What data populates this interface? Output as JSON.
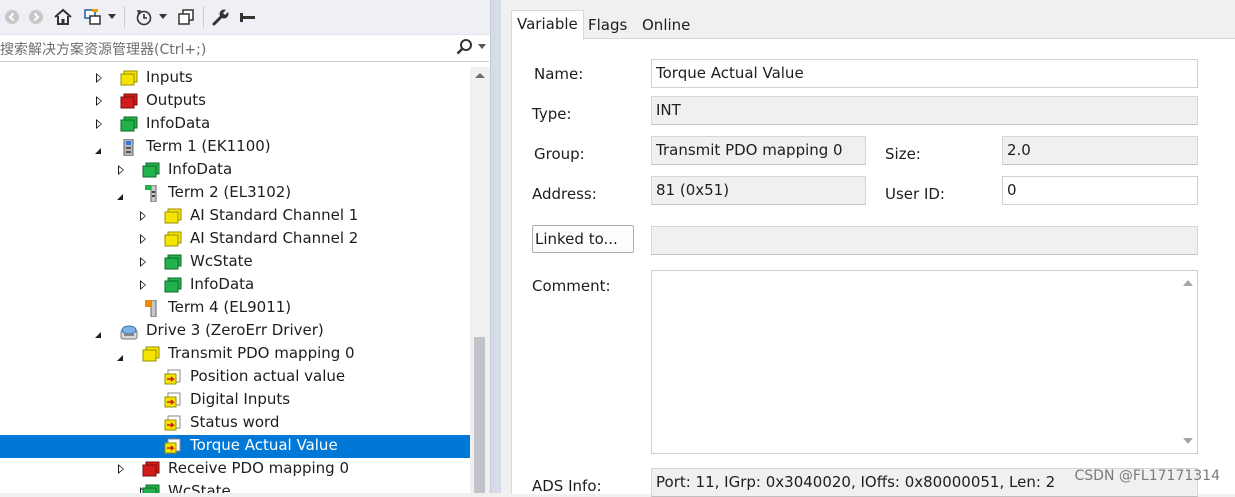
{
  "toolbar": {
    "icons": [
      "back-arrow-icon",
      "forward-arrow-icon",
      "home-icon",
      "sync-icon",
      "dropdown",
      "history-icon",
      "dropdown",
      "copy-window-icon",
      "wrench-icon",
      "minus-icon"
    ]
  },
  "search": {
    "placeholder": "搜索解决方案资源管理器(Ctrl+;)"
  },
  "tree": [
    {
      "label": "Inputs",
      "icon": "yellow",
      "expander": "closed"
    },
    {
      "label": "Outputs",
      "icon": "red",
      "expander": "closed"
    },
    {
      "label": "InfoData",
      "icon": "green",
      "expander": "closed"
    },
    {
      "label": "Term 1 (EK1100)",
      "icon": "coupler",
      "expander": "open"
    },
    {
      "label": "InfoData",
      "icon": "green",
      "expander": "closed"
    },
    {
      "label": "Term 2 (EL3102)",
      "icon": "terminal-green",
      "expander": "open"
    },
    {
      "label": "AI Standard Channel 1",
      "icon": "yellow",
      "expander": "closed"
    },
    {
      "label": "AI Standard Channel 2",
      "icon": "yellow",
      "expander": "closed"
    },
    {
      "label": "WcState",
      "icon": "green",
      "expander": "closed"
    },
    {
      "label": "InfoData",
      "icon": "green",
      "expander": "closed"
    },
    {
      "label": "Term 4 (EL9011)",
      "icon": "terminal-orange",
      "expander": "none"
    },
    {
      "label": "Drive 3 (ZeroErr Driver)",
      "icon": "drive",
      "expander": "open"
    },
    {
      "label": "Transmit PDO mapping 0",
      "icon": "yellow",
      "expander": "open"
    },
    {
      "label": "Position actual value",
      "icon": "var",
      "expander": "none"
    },
    {
      "label": "Digital Inputs",
      "icon": "var",
      "expander": "none"
    },
    {
      "label": "Status word",
      "icon": "var",
      "expander": "none"
    },
    {
      "label": "Torque Actual Value",
      "icon": "var",
      "expander": "none",
      "selected": true
    },
    {
      "label": "Receive PDO mapping 0",
      "icon": "red",
      "expander": "closed"
    },
    {
      "label": "WcState",
      "icon": "green",
      "expander": "closed"
    }
  ],
  "tabs": [
    "Variable",
    "Flags",
    "Online"
  ],
  "active_tab": "Variable",
  "form": {
    "name_label": "Name:",
    "name_value": "Torque Actual Value",
    "type_label": "Type:",
    "type_value": "INT",
    "group_label": "Group:",
    "group_value": "Transmit PDO mapping 0",
    "size_label": "Size:",
    "size_value": "2.0",
    "address_label": "Address:",
    "address_value": "81 (0x51)",
    "userid_label": "User ID:",
    "userid_value": "0",
    "linked_button": "Linked to...",
    "linked_value": "",
    "comment_label": "Comment:",
    "comment_value": "",
    "ads_label": "ADS Info:",
    "ads_value": "Port: 11, IGrp: 0x3040020, IOffs: 0x80000051, Len: 2"
  },
  "watermark": "CSDN @FL17171314",
  "colors": {
    "selection": "#0078d7",
    "yellow": "#f4e400",
    "green": "#22b14c",
    "red": "#d21c1c"
  }
}
